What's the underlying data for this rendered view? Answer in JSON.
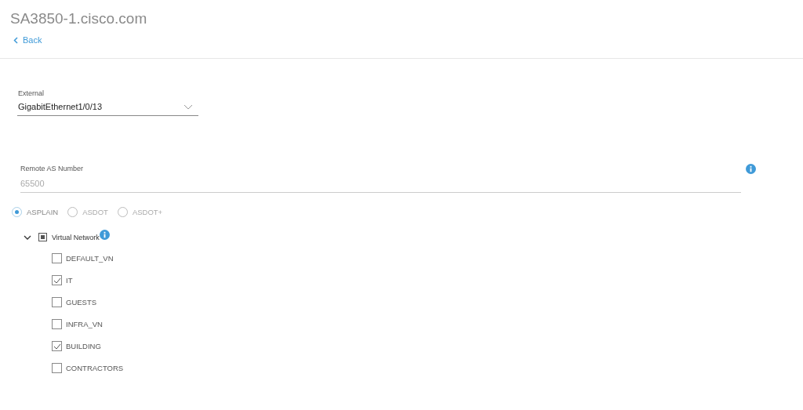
{
  "header": {
    "title": "SA3850-1.cisco.com",
    "back_link": "Back"
  },
  "external": {
    "label": "External",
    "value": "GigabitEthernet1/0/13"
  },
  "remote_as": {
    "label": "Remote AS Number",
    "placeholder": "65500"
  },
  "as_formats": [
    {
      "label": "ASPLAIN",
      "selected": true
    },
    {
      "label": "ASDOT",
      "selected": false
    },
    {
      "label": "ASDOT+",
      "selected": false
    }
  ],
  "virtual_network": {
    "label": "Virtual Network",
    "expanded": true,
    "indeterminate": true,
    "children": [
      {
        "label": "DEFAULT_VN",
        "checked": false
      },
      {
        "label": "IT",
        "checked": true
      },
      {
        "label": "GUESTS",
        "checked": false
      },
      {
        "label": "INFRA_VN",
        "checked": false
      },
      {
        "label": "BUILDING",
        "checked": true
      },
      {
        "label": "CONTRACTORS",
        "checked": false
      }
    ]
  }
}
